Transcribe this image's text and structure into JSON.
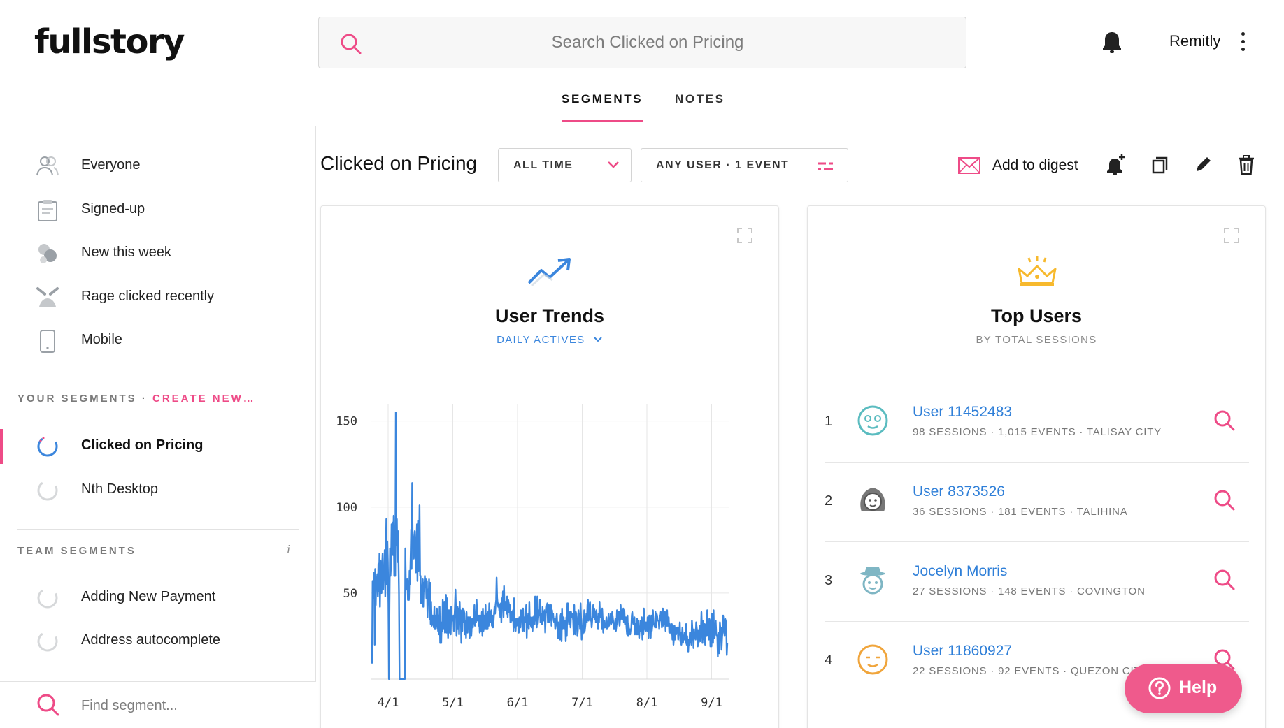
{
  "app": {
    "logo": "fullstory",
    "account": "Remitly"
  },
  "search": {
    "placeholder": "Search Clicked on Pricing"
  },
  "tabs": [
    {
      "label": "SEGMENTS",
      "active": true
    },
    {
      "label": "NOTES",
      "active": false
    }
  ],
  "sidebar": {
    "default_segments": [
      {
        "label": "Everyone",
        "icon": "users-icon"
      },
      {
        "label": "Signed-up",
        "icon": "clipboard-icon"
      },
      {
        "label": "New this week",
        "icon": "new-users-icon"
      },
      {
        "label": "Rage clicked recently",
        "icon": "angry-face-icon"
      },
      {
        "label": "Mobile",
        "icon": "mobile-icon"
      }
    ],
    "your_segments_heading": "YOUR SEGMENTS · ",
    "create_new": "CREATE NEW…",
    "your_segments": [
      {
        "label": "Clicked on Pricing",
        "active": true
      },
      {
        "label": "Nth Desktop",
        "active": false
      }
    ],
    "team_segments_heading": "TEAM SEGMENTS",
    "team_info": "i",
    "team_segments": [
      {
        "label": "Adding New Payment"
      },
      {
        "label": "Address autocomplete"
      }
    ],
    "find_placeholder": "Find segment..."
  },
  "toolbar": {
    "segment_title": "Clicked on Pricing",
    "time_filter": "ALL TIME",
    "user_filter": "ANY USER · 1 EVENT",
    "add_to_digest": "Add to digest"
  },
  "trends_card": {
    "title": "User Trends",
    "subtitle": "DAILY ACTIVES"
  },
  "top_users_card": {
    "title": "Top Users",
    "subtitle": "BY TOTAL SESSIONS",
    "users": [
      {
        "rank": "1",
        "name": "User 11452483",
        "meta": "98 SESSIONS · 1,015 EVENTS · TALISAY CITY",
        "avatar_color": "#5bbcc0"
      },
      {
        "rank": "2",
        "name": "User 8373526",
        "meta": "36 SESSIONS · 181 EVENTS · TALIHINA",
        "avatar_color": "#777777"
      },
      {
        "rank": "3",
        "name": "Jocelyn Morris",
        "meta": "27 SESSIONS · 148 EVENTS · COVINGTON",
        "avatar_color": "#7fb6c4"
      },
      {
        "rank": "4",
        "name": "User 11860927",
        "meta": "22 SESSIONS · 92 EVENTS · QUEZON CITY",
        "avatar_color": "#f0a53c"
      }
    ]
  },
  "help": {
    "label": "Help"
  },
  "colors": {
    "accent": "#ee4b87",
    "link": "#2f7fd8",
    "chart_line": "#3b86dd",
    "crown": "#f7b92d"
  },
  "chart_data": {
    "type": "line",
    "title": "User Trends",
    "subtitle": "DAILY ACTIVES",
    "xlabel": "",
    "ylabel": "",
    "x_ticks": [
      "4/1",
      "5/1",
      "6/1",
      "7/1",
      "8/1",
      "9/1"
    ],
    "y_ticks": [
      50,
      100,
      150
    ],
    "ylim": [
      0,
      160
    ],
    "grid": true,
    "series": [
      {
        "values": [
          9,
          57,
          56,
          47,
          62,
          20,
          64,
          43,
          59,
          57,
          61,
          48,
          67,
          51,
          73,
          42,
          69,
          61,
          50,
          66,
          73,
          52,
          65,
          58,
          75,
          48,
          70,
          93,
          55,
          80,
          68,
          44,
          0,
          43,
          76,
          60,
          67,
          90,
          80,
          91,
          72,
          95,
          60,
          83,
          60,
          155,
          78,
          93,
          68,
          86,
          72,
          50,
          0,
          0,
          0,
          0,
          0,
          0,
          0,
          0,
          0,
          0,
          0,
          76,
          55,
          58,
          52,
          58,
          46,
          57,
          46,
          63,
          55,
          70,
          87,
          64,
          114,
          77,
          80,
          70,
          83,
          86,
          74,
          62,
          77,
          90,
          57,
          92,
          63,
          73,
          101,
          60,
          60,
          44,
          44,
          52,
          58,
          42,
          56,
          51,
          60,
          54,
          58,
          47,
          57,
          36,
          52,
          44,
          58,
          35,
          56,
          32,
          45,
          31,
          32,
          37,
          36,
          30,
          42,
          29,
          37,
          29,
          32,
          41,
          34,
          28,
          37,
          26,
          42,
          21,
          33,
          21,
          33,
          28,
          46,
          29,
          40,
          45,
          27,
          35,
          49,
          27,
          47,
          33,
          24,
          40,
          27,
          40,
          38,
          26,
          42,
          34,
          34,
          35,
          37,
          28,
          35,
          42,
          52,
          40,
          25,
          31,
          42,
          29,
          41,
          26,
          45,
          34,
          40,
          21,
          38,
          28,
          41,
          33,
          40,
          38,
          26,
          34,
          24,
          39,
          31,
          27,
          36,
          29,
          36,
          24,
          36,
          35,
          25,
          31,
          35,
          30,
          33,
          34,
          43,
          31,
          38,
          33,
          46,
          39,
          34,
          37,
          31,
          37,
          27,
          37,
          30,
          28,
          39,
          25,
          41,
          28,
          37,
          29,
          32,
          43,
          29,
          29,
          38,
          29,
          39,
          31,
          44,
          35,
          39,
          33,
          40,
          31,
          37,
          30,
          32,
          38,
          42,
          38,
          43,
          46,
          59,
          47,
          44,
          42,
          44,
          40,
          43,
          36,
          44,
          33,
          47,
          41,
          51,
          36,
          54,
          40,
          45,
          40,
          45,
          38,
          48,
          36,
          46,
          44,
          39,
          43,
          33,
          33,
          36,
          39,
          34,
          40,
          28,
          47,
          30,
          34,
          28,
          35,
          31,
          35,
          35,
          32,
          27,
          36,
          33,
          30,
          40,
          34,
          39,
          28,
          41,
          33,
          28,
          36,
          33,
          36,
          43,
          24,
          37,
          30,
          38,
          29,
          45,
          32,
          36,
          31,
          30,
          36,
          28,
          36,
          33,
          37,
          32,
          48,
          34,
          38,
          30,
          48,
          32,
          36,
          40,
          37,
          46,
          33,
          38,
          33,
          32,
          42,
          36,
          34,
          38,
          40,
          27,
          38,
          39,
          42,
          44,
          33,
          41,
          43,
          33,
          35,
          39,
          43,
          31,
          40,
          36,
          38,
          34,
          33,
          35,
          29,
          32,
          35,
          38,
          31,
          24,
          33,
          24,
          31,
          23,
          37,
          38,
          22,
          41,
          29,
          32,
          36,
          29,
          34,
          33,
          22,
          36,
          25,
          44,
          44,
          36,
          32,
          37,
          39,
          30,
          39,
          36,
          38,
          37,
          34,
          26,
          43,
          28,
          26,
          39,
          38,
          32,
          25,
          29,
          40,
          32,
          38,
          29,
          44,
          35,
          23,
          31,
          26,
          35,
          27,
          40,
          28,
          31,
          35,
          38,
          33,
          43,
          46,
          34,
          35,
          43,
          45,
          34,
          35,
          30,
          34,
          39,
          43,
          36,
          41,
          35,
          39,
          33,
          40,
          34,
          36,
          29,
          38,
          33,
          45,
          36,
          39,
          40,
          29,
          41,
          34,
          27,
          32,
          34,
          30,
          31,
          30,
          36,
          29,
          33,
          30,
          38,
          31,
          33,
          33,
          38,
          32,
          33,
          39,
          36,
          33,
          29,
          29,
          32,
          35,
          28,
          31,
          40,
          32,
          39,
          36,
          39,
          31,
          36,
          43,
          35,
          38,
          35,
          35,
          41,
          33,
          40,
          32,
          34,
          36,
          30,
          26,
          37,
          25,
          32,
          28,
          29,
          26,
          29,
          29,
          37,
          39,
          34,
          32,
          32,
          36,
          26,
          32,
          31,
          26,
          35,
          26,
          30,
          34,
          24,
          30,
          28,
          34,
          31,
          36,
          23,
          31,
          26,
          41,
          29,
          30,
          28,
          33,
          31,
          28,
          36,
          31,
          24,
          37,
          31,
          35,
          24,
          37,
          28,
          31,
          40,
          33,
          32,
          31,
          30,
          39,
          30,
          38,
          37,
          34,
          34,
          34,
          29,
          37,
          34,
          39,
          38,
          30,
          35,
          41,
          31,
          39,
          32,
          39,
          28,
          38,
          31,
          40,
          31,
          34,
          36,
          27,
          32,
          27,
          31,
          26,
          32,
          23,
          31,
          20,
          24,
          31,
          23,
          30,
          26,
          29,
          30,
          30,
          23,
          30,
          26,
          33,
          22,
          27,
          20,
          25,
          30,
          21,
          24,
          23,
          27,
          25,
          21,
          32,
          20,
          25,
          17,
          16,
          23,
          20,
          27,
          27,
          22,
          20,
          34,
          28,
          26,
          18,
          29,
          24,
          26,
          23,
          33,
          30,
          27,
          19,
          28,
          21,
          29,
          31,
          22,
          29,
          39,
          29,
          21,
          34,
          25,
          23,
          32,
          20,
          28,
          32,
          25,
          40,
          27,
          26,
          23,
          35,
          34,
          19,
          28,
          19,
          38,
          31,
          21,
          40,
          24,
          24,
          31,
          34,
          27,
          25,
          25,
          13,
          27,
          22,
          15,
          33,
          28,
          30,
          17,
          24,
          28,
          37,
          34,
          27,
          25,
          35,
          34,
          32,
          14,
          21
        ]
      }
    ]
  }
}
